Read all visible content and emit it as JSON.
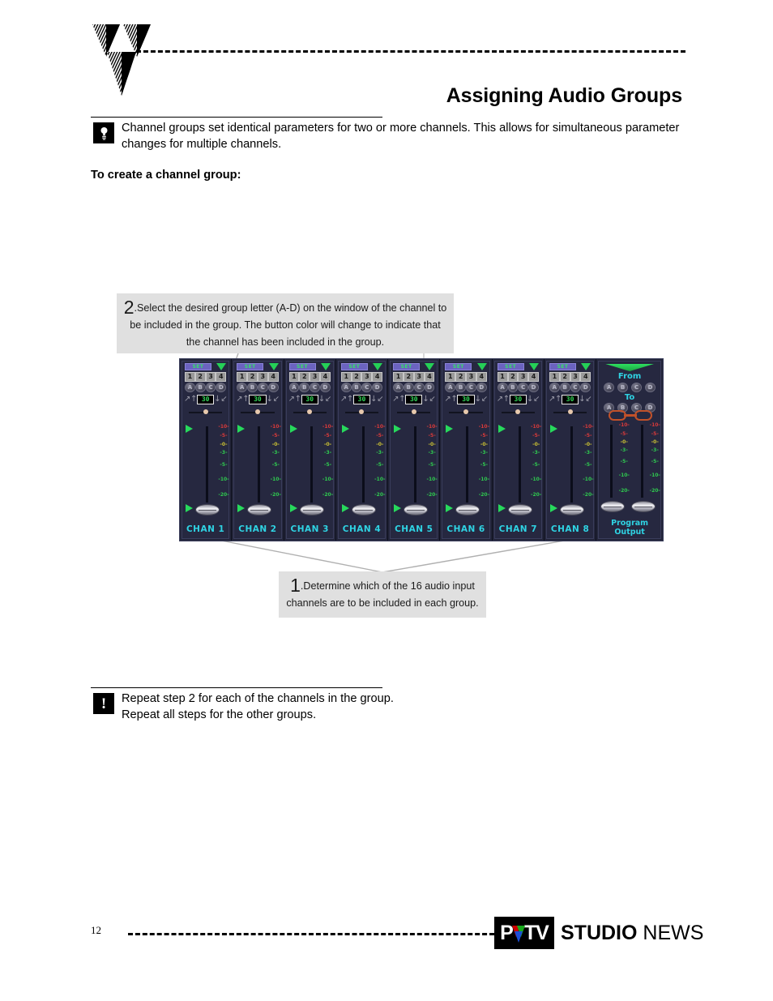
{
  "document": {
    "page_number": "12",
    "title": "Assigning Audio Groups",
    "subheading": "To create a channel group:"
  },
  "tip_note": {
    "icon": "lightbulb-icon",
    "text": "Channel groups set identical parameters for two or more channels.  This allows for simultaneous parameter changes for multiple channels."
  },
  "callouts": [
    {
      "number": "2",
      "text": ".Select the desired group letter (A-D) on the window of the channel to be included in the group.  The button color will change to indicate that the channel has been included in the group."
    },
    {
      "number": "1",
      "text": ".Determine which of the 16 audio input channels are to be included in each group."
    }
  ],
  "bottom_note": {
    "icon": "exclamation-icon",
    "line1": "Repeat step 2 for each of the channels in the group.",
    "line2": "Repeat all steps for the other groups."
  },
  "footer": {
    "logo_p": "P",
    "logo_tv": "TV",
    "brand_bold": "STUDIO",
    "brand_light": "NEWS",
    "logo_triangle_colors": [
      "#cc0000",
      "#17a81a",
      "#1b4fd8"
    ]
  },
  "mixer": {
    "set_label": "SET",
    "number_buttons": [
      "1",
      "2",
      "3",
      "4"
    ],
    "group_buttons": [
      "A",
      "B",
      "C",
      "D"
    ],
    "value_display": "30",
    "arrow_icons": [
      "arrow-up-right-icon",
      "arrow-up-icon",
      "arrow-down-icon",
      "arrow-down-left-icon"
    ],
    "scale_ticks": [
      {
        "label": "10",
        "color": "#d83a3a",
        "pos": 0
      },
      {
        "label": "5",
        "color": "#d83a3a",
        "pos": 11
      },
      {
        "label": "0",
        "color": "#ccc233",
        "pos": 22
      },
      {
        "label": "3",
        "color": "#2fc94f",
        "pos": 32
      },
      {
        "label": "5",
        "color": "#2fc94f",
        "pos": 47
      },
      {
        "label": "10",
        "color": "#2fc94f",
        "pos": 65
      },
      {
        "label": "20",
        "color": "#2fc94f",
        "pos": 84
      }
    ],
    "channels": [
      {
        "label": "CHAN 1"
      },
      {
        "label": "CHAN 2"
      },
      {
        "label": "CHAN 3"
      },
      {
        "label": "CHAN 4"
      },
      {
        "label": "CHAN 5"
      },
      {
        "label": "CHAN 6"
      },
      {
        "label": "CHAN 7"
      },
      {
        "label": "CHAN 8"
      }
    ],
    "program": {
      "from_label": "From",
      "to_label": "To",
      "caption_line1": "Program",
      "caption_line2": "Output",
      "group_buttons": [
        "A",
        "B",
        "C",
        "D"
      ],
      "chain_icon": "chain-link-icon"
    },
    "colors": {
      "background": "#23253a",
      "label_cyan": "#2fd3e3",
      "set_purple": "#6b63c0",
      "accent_green": "#27d95c",
      "value_green": "#34d85a"
    }
  }
}
